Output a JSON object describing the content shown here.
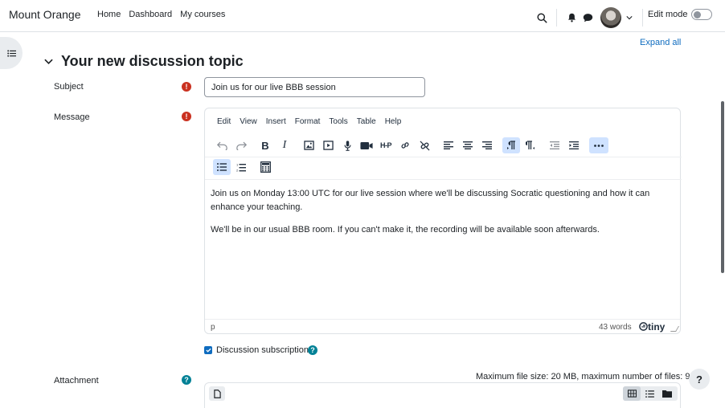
{
  "navbar": {
    "site_name": "Mount Orange",
    "links": [
      "Home",
      "Dashboard",
      "My courses"
    ],
    "edit_mode_label": "Edit mode"
  },
  "page": {
    "expand_all": "Expand all",
    "section_title": "Your new discussion topic"
  },
  "form": {
    "subject_label": "Subject",
    "subject_value": "Join us for our live BBB session",
    "message_label": "Message",
    "attachment_label": "Attachment",
    "subscription_label": "Discussion subscription",
    "subscription_checked": true,
    "max_file_info": "Maximum file size: 20 MB, maximum number of files: 9"
  },
  "editor": {
    "menus": [
      "Edit",
      "View",
      "Insert",
      "Format",
      "Tools",
      "Table",
      "Help"
    ],
    "paragraphs": [
      "Join us on Monday 13:00 UTC for our live session where we'll be discussing Socratic questioning and how it can enhance your teaching.",
      "We'll be in our usual BBB room. If you can't make it, the recording will be available soon afterwards."
    ],
    "status_path": "p",
    "word_count": "43 words",
    "brand": "tiny"
  },
  "icons": {
    "required": "!",
    "help": "?",
    "h5p": "H-P"
  },
  "colors": {
    "accent": "#0f6cbf",
    "required": "#ca3120",
    "help": "#008196",
    "active_button": "#cfe2ff"
  }
}
